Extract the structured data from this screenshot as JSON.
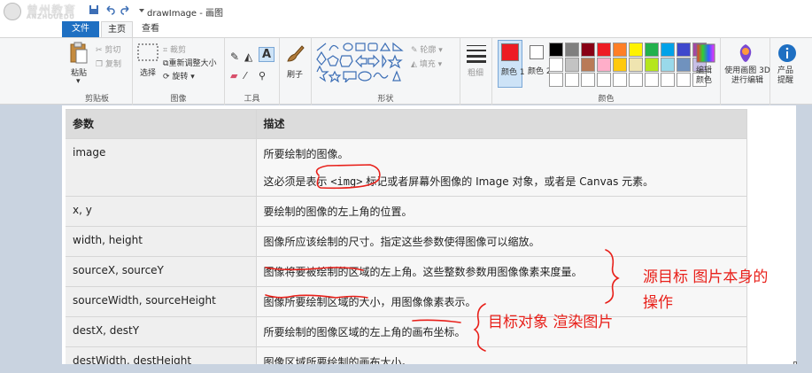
{
  "watermark": {
    "main": "曾州教育",
    "sub": "ANZHOUEDU"
  },
  "window": {
    "title": "drawImage - 画图"
  },
  "tabs": {
    "file": "文件",
    "home": "主页",
    "view": "查看"
  },
  "ribbon": {
    "clipboard": {
      "paste": "粘贴",
      "cut": "剪切",
      "copy": "复制",
      "label": "剪贴板"
    },
    "image": {
      "select": "选择",
      "crop": "裁剪",
      "resize": "重新调整大小",
      "rotate": "旋转",
      "label": "图像"
    },
    "tools": {
      "label": "工具"
    },
    "brushes": {
      "label": "刷子"
    },
    "shapes": {
      "outline": "轮廓",
      "fill": "填充",
      "label": "形状"
    },
    "size": {
      "label": "粗细"
    },
    "colors": {
      "color1": "颜色 1",
      "color2": "颜色 2",
      "edit": "编辑颜色",
      "label": "颜色"
    },
    "paint3d": "使用画图 3D 进行编辑",
    "alert": "产品提醒"
  },
  "palette": [
    "#000000",
    "#7f7f7f",
    "#880015",
    "#ed1c24",
    "#ff7f27",
    "#fff200",
    "#22b14c",
    "#00a2e8",
    "#3f48cc",
    "#a349a4",
    "#ffffff",
    "#c3c3c3",
    "#b97a57",
    "#ffaec9",
    "#ffc90e",
    "#efe4b0",
    "#b5e61d",
    "#99d9ea",
    "#7092be",
    "#c8bfe7",
    "#ffffff",
    "#ffffff",
    "#ffffff",
    "#ffffff",
    "#ffffff",
    "#ffffff",
    "#ffffff",
    "#ffffff",
    "#ffffff",
    "#ffffff"
  ],
  "color1": "#ed1c24",
  "table": {
    "headers": [
      "参数",
      "描述"
    ],
    "rows": [
      {
        "param": "image",
        "desc": "所要绘制的图像。",
        "desc2_pre": "这必须是表示 ",
        "desc2_code": "<img>",
        "desc2_post": " 标记或者屏幕外图像的 Image 对象，或者是 Canvas 元素。"
      },
      {
        "param": "x, y",
        "desc": "要绘制的图像的左上角的位置。"
      },
      {
        "param": "width, height",
        "desc": "图像所应该绘制的尺寸。指定这些参数使得图像可以缩放。"
      },
      {
        "param": "sourceX, sourceY",
        "desc": "图像将要被绘制的区域的左上角。这些整数参数用图像像素来度量。"
      },
      {
        "param": "sourceWidth, sourceHeight",
        "desc": "图像所要绘制区域的大小，用图像像素表示。"
      },
      {
        "param": "destX, destY",
        "desc": "所要绘制的图像区域的左上角的画布坐标。"
      },
      {
        "param": "destWidth, destHeight",
        "desc": "图像区域所要绘制的画布大小。"
      }
    ]
  },
  "annotations": {
    "source": "源目标 图片本身的",
    "source2": "操作",
    "dest": "目标对象 渲染图片"
  }
}
